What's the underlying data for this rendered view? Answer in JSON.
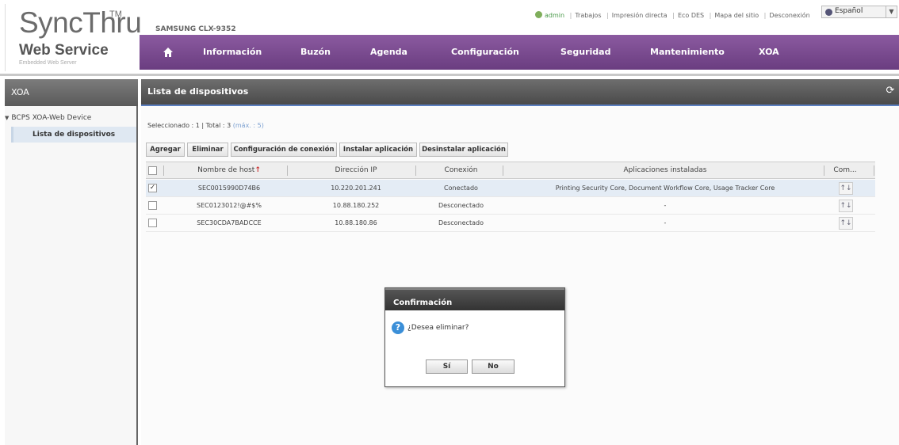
{
  "brand": {
    "title": "SyncThru",
    "tm": "TM",
    "subtitle": "Web Service",
    "tagline": "Embedded Web Server",
    "model": "SAMSUNG CLX-9352"
  },
  "toplinks": {
    "user": "admin",
    "items": [
      "Trabajos",
      "Impresión directa",
      "Eco DES",
      "Mapa del sitio",
      "Desconexión"
    ],
    "language": "Español"
  },
  "nav": {
    "items": [
      "Información",
      "Buzón",
      "Agenda",
      "Configuración",
      "Seguridad",
      "Mantenimiento",
      "XOA"
    ]
  },
  "sidebar": {
    "title": "XOA",
    "tree_root": "BCPS XOA-Web Device",
    "tree_selected": "Lista de dispositivos"
  },
  "main": {
    "title": "Lista de dispositivos",
    "summary": "Seleccionado : 1 | Total : 3",
    "summary_max": "(máx. : 5)",
    "toolbar": {
      "add": "Agregar",
      "delete": "Eliminar",
      "connection_settings": "Configuración de conexión",
      "install_app": "Instalar aplicación",
      "uninstall_app": "Desinstalar aplicación"
    },
    "columns": {
      "hostname": "Nombre de host",
      "ip": "Dirección IP",
      "connection": "Conexión",
      "apps": "Aplicaciones instaladas",
      "com": "Com..."
    },
    "rows": [
      {
        "checked": "✓",
        "hostname": "SEC0015990D74B6",
        "ip": "10.220.201.241",
        "connection": "Conectado",
        "apps": "Printing Security Core, Document Workflow Core, Usage Tracker Core",
        "com": "↑↓"
      },
      {
        "checked": "",
        "hostname": "SEC0123012!@#$%",
        "ip": "10.88.180.252",
        "connection": "Desconectado",
        "apps": "-",
        "com": "↑↓"
      },
      {
        "checked": "",
        "hostname": "SEC30CDA7BADCCE",
        "ip": "10.88.180.86",
        "connection": "Desconectado",
        "apps": "-",
        "com": "↑↓"
      }
    ]
  },
  "dialog": {
    "title": "Confirmación",
    "icon": "?",
    "message": "¿Desea eliminar?",
    "yes": "Sí",
    "no": "No"
  },
  "colors": {
    "nav_bg": "#7a4b8e",
    "selected_row": "#e4ecf5",
    "accent_blue": "#5b7fc0"
  }
}
